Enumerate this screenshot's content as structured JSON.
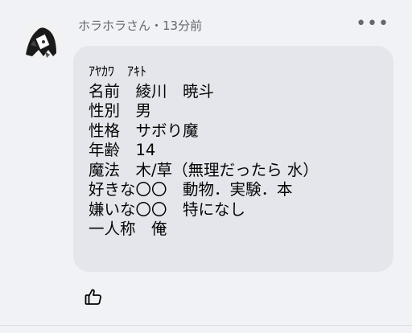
{
  "comment": {
    "author_line": "ホラホラさん・13分前",
    "more_label": "•••",
    "lines": [
      "ｱﾔｶﾜ　ｱｷﾄ",
      "名前　綾川　暁斗",
      "性別　男",
      "性格　サボり魔",
      "年齢　14",
      "魔法　木/草（無理だったら 水）",
      "好きな〇〇　動物．実験．本",
      "嫌いな〇〇　特になし",
      "一人称　俺"
    ]
  },
  "icons": {
    "avatar": "avatar-image",
    "more": "more-options-icon",
    "like": "thumbs-up-icon"
  }
}
